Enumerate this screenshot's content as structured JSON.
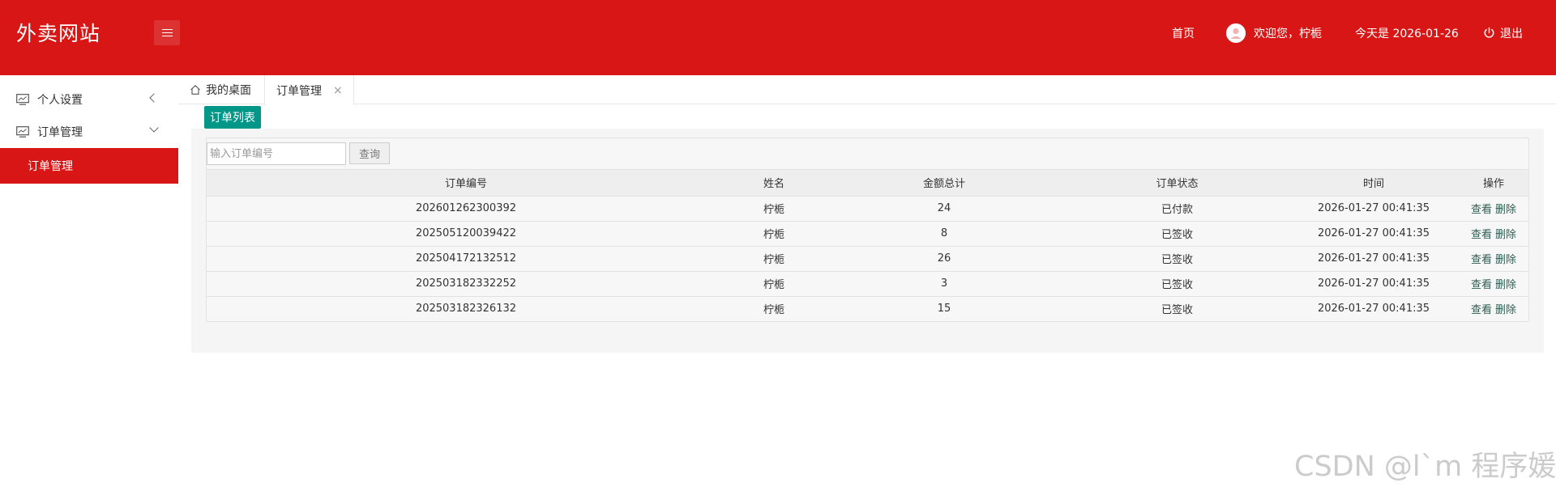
{
  "header": {
    "logo": "外卖网站",
    "home": "首页",
    "welcome": "欢迎您，柠栀",
    "date": "今天是 2026-01-26",
    "logout": "退出",
    "bg_color": "#d91616"
  },
  "sidebar": {
    "items": [
      {
        "label": "个人设置",
        "icon": "monitor-icon",
        "chevron": "chevron-left-icon"
      },
      {
        "label": "订单管理",
        "icon": "monitor-icon",
        "chevron": "chevron-down-icon"
      }
    ],
    "active_sub": "订单管理"
  },
  "tabs": {
    "desk": "我的桌面",
    "order": "订单管理",
    "close": "×"
  },
  "content": {
    "list_button": "订单列表",
    "search_placeholder": "输入订单编号",
    "search_button": "查询",
    "accent_color": "#009688"
  },
  "table": {
    "headers": [
      "订单编号",
      "姓名",
      "金额总计",
      "订单状态",
      "时间",
      "操作"
    ],
    "rows": [
      [
        "202601262300392",
        "柠栀",
        "24",
        "已付款",
        "2026-01-27 00:41:35"
      ],
      [
        "202505120039422",
        "柠栀",
        "8",
        "已签收",
        "2026-01-27 00:41:35"
      ],
      [
        "202504172132512",
        "柠栀",
        "26",
        "已签收",
        "2026-01-27 00:41:35"
      ],
      [
        "202503182332252",
        "柠栀",
        "3",
        "已签收",
        "2026-01-27 00:41:35"
      ],
      [
        "202503182326132",
        "柠栀",
        "15",
        "已签收",
        "2026-01-27 00:41:35"
      ]
    ],
    "view_label": "查看",
    "delete_label": "删除"
  },
  "watermark": "CSDN @l`m 程序媛"
}
